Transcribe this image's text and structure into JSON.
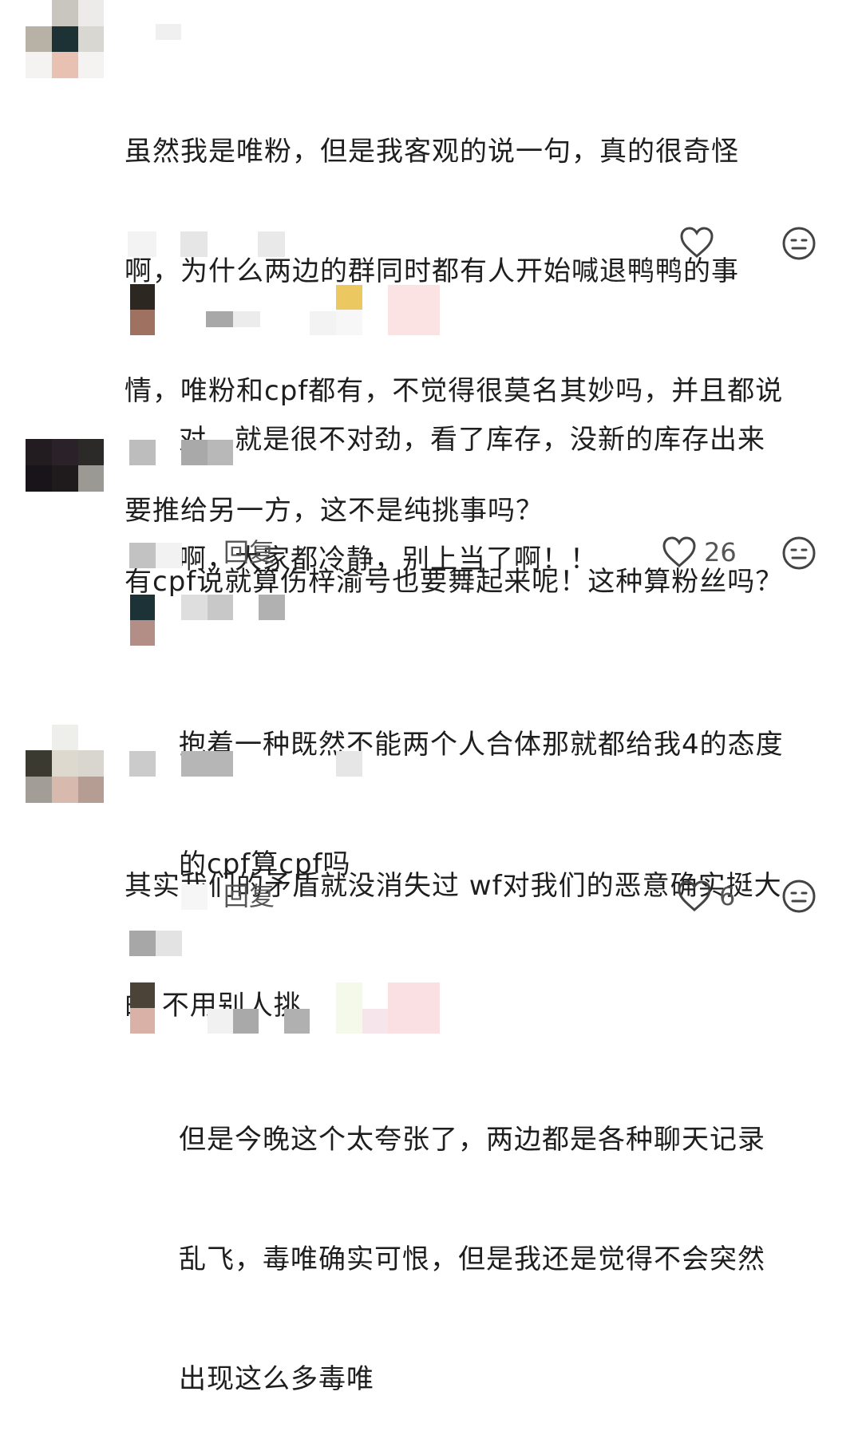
{
  "comments": [
    {
      "lines": [
        "虽然我是唯粉，但是我客观的说一句，真的很奇怪",
        "啊，为什么两边的群同时都有人开始喊退鸭鸭的事",
        "情，唯粉和cpf都有，不觉得很莫名其妙吗，并且都说",
        "要推给另一方，这不是纯挑事吗？"
      ]
    },
    {
      "lines": [
        "对，就是很不对劲，看了库存，没新的库存出来",
        "啊，大家都冷静，别上当了啊！！"
      ]
    },
    {
      "lines": [
        "有cpf说就算伤梓渝号也要舞起来呢！这种算粉丝吗？"
      ],
      "reply_label": "回复",
      "like_count": "26"
    },
    {
      "lines": [
        "抱着一种既然不能两个人合体那就都给我4的态度",
        "的cpf算cpf吗"
      ]
    },
    {
      "lines": [
        "其实我们的矛盾就没消失过 wf对我们的恶意确实挺大",
        "的 不用别人挑"
      ],
      "reply_label": "回复",
      "like_count": "6"
    },
    {
      "lines": [
        "但是今晚这个太夸张了，两边都是各种聊天记录",
        "乱飞，毒唯确实可恨，但是我还是觉得不会突然",
        "出现这么多毒唯"
      ]
    }
  ],
  "icons": {
    "like": "heart-outline-icon",
    "dislike": "neutral-face-icon"
  },
  "colors": {
    "text": "#1e1e1e",
    "secondary_text": "#555555",
    "icon": "#444444",
    "mosaic_gray": "#cfcfcf"
  }
}
